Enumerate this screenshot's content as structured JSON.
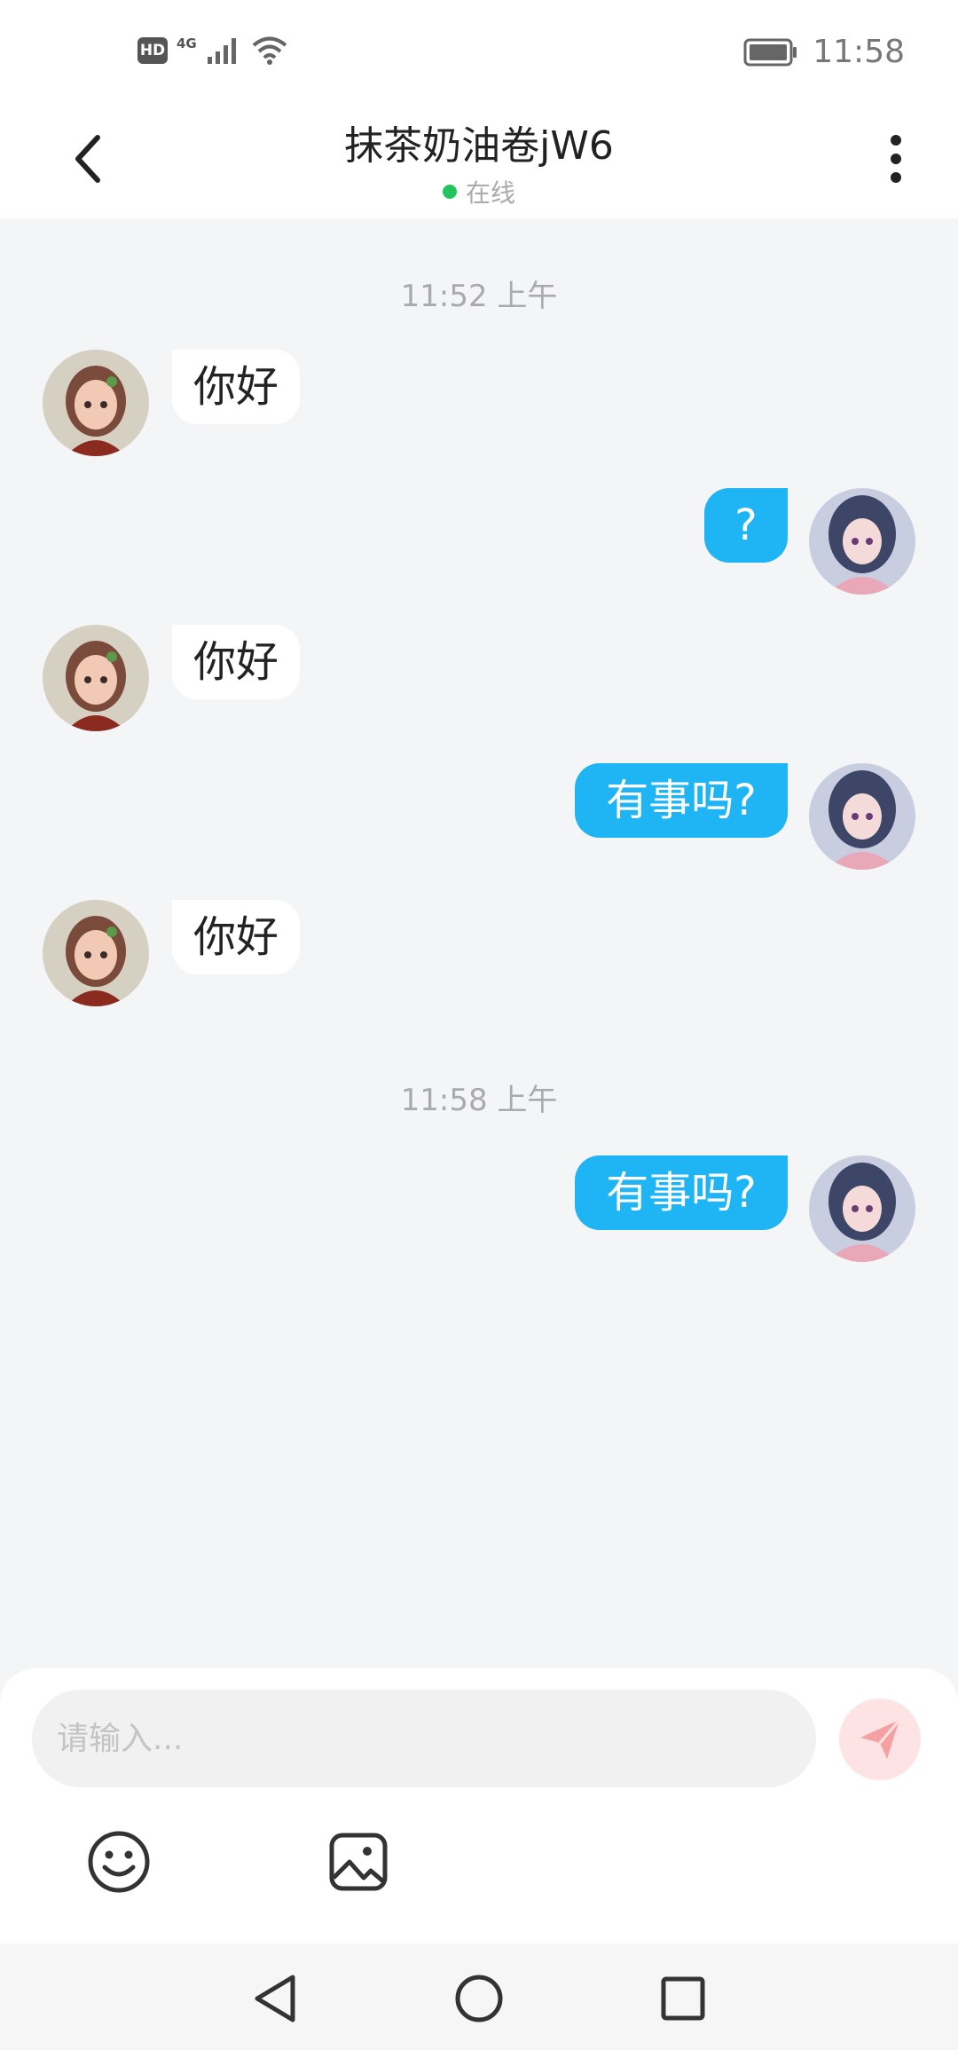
{
  "status_bar": {
    "hd_badge": "HD",
    "network": "4G",
    "time": "11:58"
  },
  "header": {
    "title": "抹茶奶油卷jW6",
    "status": "在线",
    "status_color": "#22c55e"
  },
  "messages": {
    "timestamp_1": "11:52 上午",
    "m1": "你好",
    "m2": "?",
    "m3": "你好",
    "m4": "有事吗?",
    "m5": "你好",
    "timestamp_2": "11:58 上午",
    "m6": "有事吗?"
  },
  "composer": {
    "placeholder": "请输入..."
  },
  "colors": {
    "outgoing_bubble": "#1fb5f5",
    "incoming_bubble": "#ffffff",
    "send_button": "#fde3e3",
    "send_icon": "#f6a1a1"
  }
}
